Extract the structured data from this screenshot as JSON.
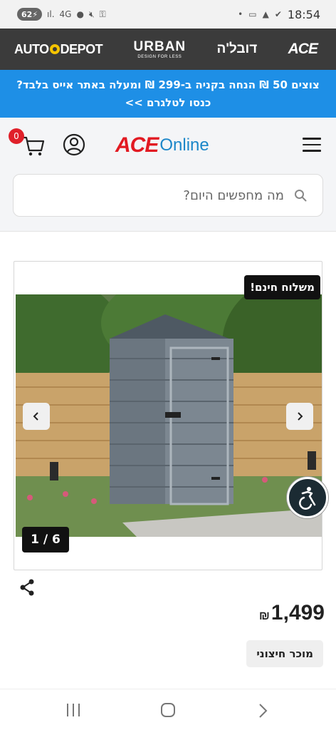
{
  "status_bar": {
    "battery": "62",
    "signal_text": "4G",
    "time": "18:54"
  },
  "brands": {
    "autodepot_pre": "AUTO",
    "autodepot_post": "DEPOT",
    "urban": "URBAN",
    "urban_tagline": "DESIGN FOR LESS",
    "dubila": "דובל'ה",
    "ace": "ACE"
  },
  "promo": {
    "line1": "צוצים 50 ₪ הנחה בקניה ב-299 ₪ ומעלה באתר אייס בלבד?",
    "line2": "כנסו לטלגרם >>"
  },
  "header": {
    "cart_count": "0",
    "logo_ace": "ACE",
    "logo_online": "Online"
  },
  "search": {
    "placeholder": "מה מחפשים היום?"
  },
  "product": {
    "free_shipping": "משלוח חינם!",
    "image_counter": "1 / 6",
    "price": "1,499",
    "currency": "₪",
    "seller": "מוכר חיצוני"
  },
  "colors": {
    "promo_bg": "#1e8fe6",
    "brand_bar_bg": "#3b3b3b",
    "cart_badge": "#e0202a",
    "logo_red": "#e21a22",
    "logo_blue": "#1c87c9"
  }
}
